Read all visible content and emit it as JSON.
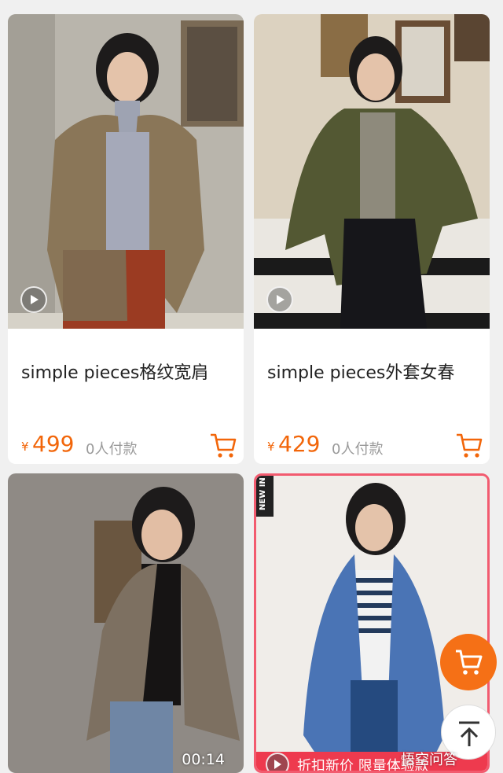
{
  "products": [
    {
      "title": "simple pieces格纹宽肩",
      "currency": "¥",
      "price": "499",
      "paid": "0人付款",
      "has_video": true
    },
    {
      "title": "simple pieces外套女春",
      "currency": "¥",
      "price": "429",
      "paid": "0人付款",
      "has_video": true
    },
    {
      "duration": "00:14"
    },
    {
      "badge": "NEW IN",
      "banner_text": "折扣新价  限量体验款"
    }
  ],
  "watermark": "悟空问答",
  "colors": {
    "accent": "#f2660a",
    "banner": "#ee3a4e",
    "card_border": "#f25b6f"
  }
}
